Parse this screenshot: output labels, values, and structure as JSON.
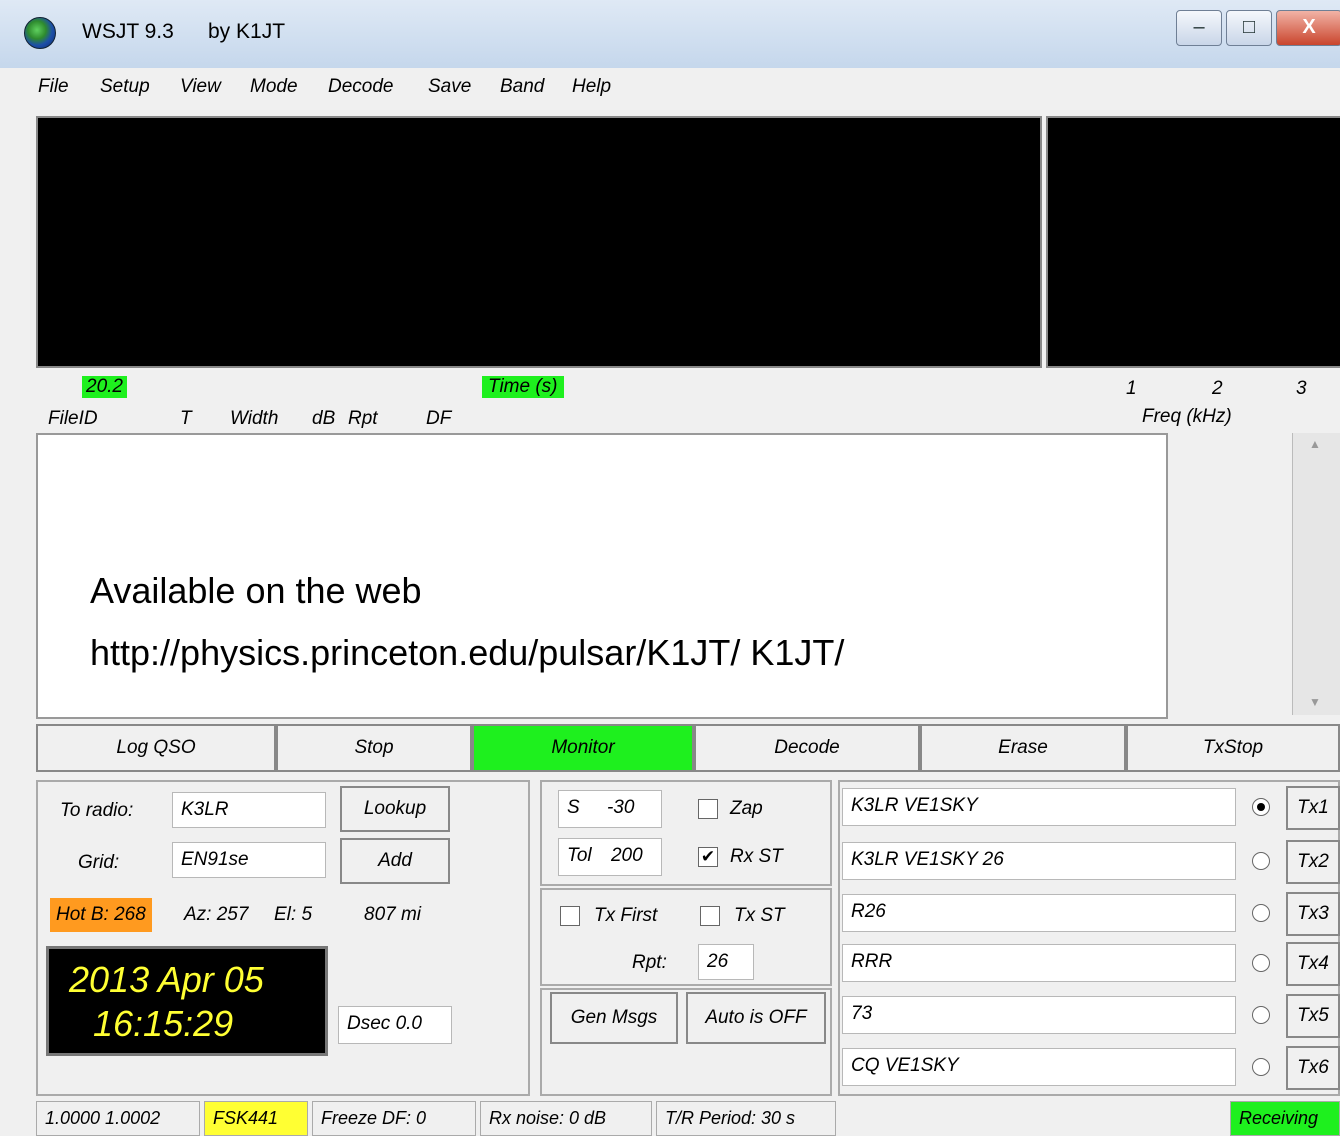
{
  "colors": {
    "accent_green": "#1ef01e",
    "hot": "#ff9a1f",
    "mode_yellow": "#ffff33",
    "clock_bg": "#000000",
    "clock_fg": "#ffff33"
  },
  "window": {
    "title": "WSJT 9.3",
    "author": "by K1JT",
    "minimize": "–",
    "maximize": "□",
    "close": "X"
  },
  "menu": [
    "File",
    "Setup",
    "View",
    "Mode",
    "Decode",
    "Save",
    "Band",
    "Help"
  ],
  "display": {
    "time_value": "20.2",
    "time_label": "Time (s)",
    "freq_ticks": [
      "1",
      "2",
      "3"
    ],
    "freq_label": "Freq (kHz)"
  },
  "columns": [
    "FileID",
    "T",
    "Width",
    "dB",
    "Rpt",
    "DF"
  ],
  "annotation": {
    "line1": "Available on the web",
    "line2": "http://physics.princeton.edu/pulsar/K1JT/ K1JT/"
  },
  "buttons": {
    "log_qso": "Log QSO",
    "stop": "Stop",
    "monitor": "Monitor",
    "decode": "Decode",
    "erase": "Erase",
    "txstop": "TxStop"
  },
  "station": {
    "to_radio_label": "To radio:",
    "to_radio_value": "K3LR",
    "lookup": "Lookup",
    "grid_label": "Grid:",
    "grid_value": "EN91se",
    "add": "Add",
    "hot_b": "Hot B: 268",
    "az": "Az: 257",
    "el": "El: 5",
    "distance": "807 mi",
    "date": "2013 Apr 05",
    "time": "16:15:29",
    "dsec": "Dsec  0.0"
  },
  "controls": {
    "s_label": "S",
    "s_value": "-30",
    "zap": "Zap",
    "zap_checked": false,
    "tol_label": "Tol",
    "tol_value": "200",
    "rx_st": "Rx ST",
    "rx_st_checked": true,
    "tx_first": "Tx First",
    "tx_first_checked": false,
    "tx_st": "Tx ST",
    "tx_st_checked": false,
    "rpt_label": "Rpt:",
    "rpt_value": "26",
    "gen_msgs": "Gen Msgs",
    "auto": "Auto is OFF"
  },
  "messages": [
    {
      "text": "K3LR VE1SKY",
      "tx": "Tx1",
      "selected": true
    },
    {
      "text": "K3LR VE1SKY 26",
      "tx": "Tx2",
      "selected": false
    },
    {
      "text": "R26",
      "tx": "Tx3",
      "selected": false
    },
    {
      "text": "RRR",
      "tx": "Tx4",
      "selected": false
    },
    {
      "text": "73",
      "tx": "Tx5",
      "selected": false
    },
    {
      "text": "CQ VE1SKY",
      "tx": "Tx6",
      "selected": false
    }
  ],
  "statusbar": {
    "clock_ratio": "1.0000 1.0002",
    "mode": "FSK441",
    "freeze_df": "Freeze DF:  0",
    "rx_noise": "Rx noise:  0 dB",
    "tr_period": "T/R Period: 30 s",
    "receiving": "Receiving"
  }
}
